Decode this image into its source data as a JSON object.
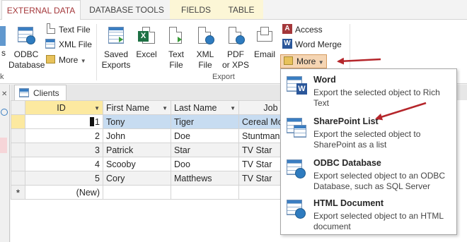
{
  "tabs": [
    {
      "label": "EXTERNAL DATA",
      "active": true
    },
    {
      "label": "DATABASE TOOLS"
    },
    {
      "label": "FIELDS",
      "contextual": true
    },
    {
      "label": "TABLE",
      "contextual": true
    }
  ],
  "ribbon": {
    "left_partial": {
      "label_s": "s",
      "label_k": "k"
    },
    "odbc_label": "ODBC\nDatabase",
    "text_file_label": "Text File",
    "xml_file_small_label": "XML File",
    "more_import_label": "More",
    "export": {
      "saved_exports_label": "Saved\nExports",
      "excel_label": "Excel",
      "text_file_label": "Text\nFile",
      "xml_file_label": "XML\nFile",
      "pdf_xps_label": "PDF\nor XPS",
      "email_label": "Email",
      "access_label": "Access",
      "word_merge_label": "Word Merge",
      "more_label": "More",
      "group_label": "Export"
    }
  },
  "document_tab": {
    "label": "Clients"
  },
  "table": {
    "columns": [
      "ID",
      "First Name",
      "Last Name",
      "Job"
    ],
    "rows": [
      {
        "id": "1",
        "first": "Tony",
        "last": "Tiger",
        "job": "Cereal Mod"
      },
      {
        "id": "2",
        "first": "John",
        "last": "Doe",
        "job": "Stuntman"
      },
      {
        "id": "3",
        "first": "Patrick",
        "last": "Star",
        "job": "TV Star"
      },
      {
        "id": "4",
        "first": "Scooby",
        "last": "Doo",
        "job": "TV Star"
      },
      {
        "id": "5",
        "first": "Cory",
        "last": "Matthews",
        "job": "TV Star"
      }
    ],
    "new_row_label": "(New)",
    "new_row_marker": "*"
  },
  "more_menu": {
    "items": [
      {
        "title": "Word",
        "desc": "Export the selected object to Rich Text",
        "icon": "word-icon"
      },
      {
        "title": "SharePoint List",
        "desc": "Export the selected object to SharePoint as a list",
        "icon": "sharepoint-list-icon"
      },
      {
        "title": "ODBC Database",
        "desc": "Export selected object to an ODBC Database, such as SQL Server",
        "icon": "odbc-database-icon"
      },
      {
        "title": "HTML Document",
        "desc": "Export selected object to an HTML document",
        "icon": "html-document-icon"
      }
    ]
  },
  "colors": {
    "active_tab_text": "#a4373a",
    "annotation_arrow": "#b5262b",
    "selected_row": "#c7dcf1",
    "id_header": "#fce9a0"
  }
}
